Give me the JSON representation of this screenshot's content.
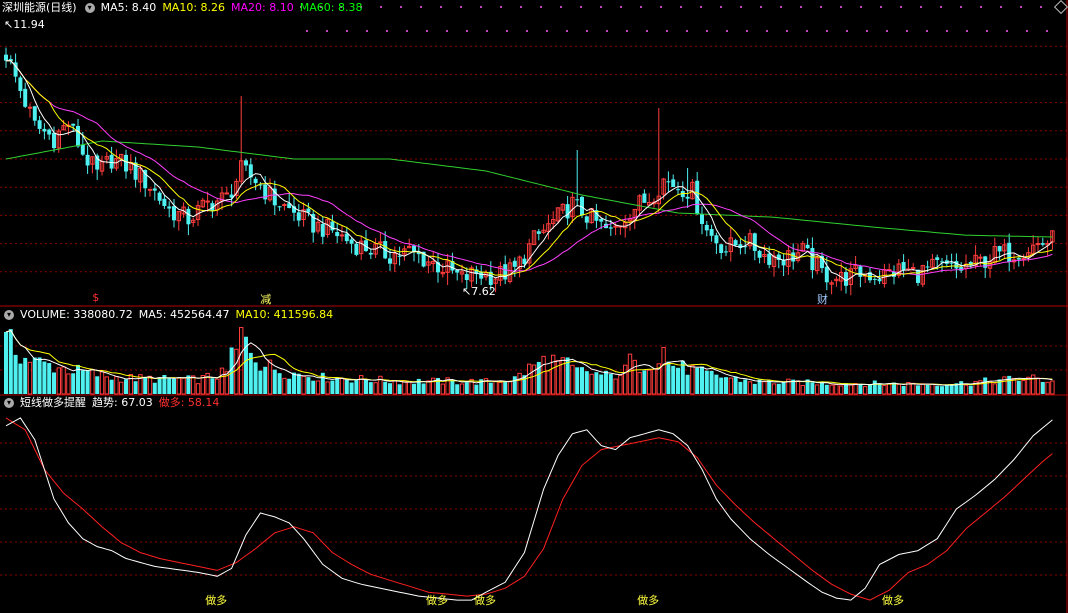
{
  "stock_name": "深圳能源",
  "period_label": "(日线)",
  "ma_legend": [
    {
      "label": "MA5: ",
      "value": "8.40",
      "color": "#ffffff"
    },
    {
      "label": "MA10: ",
      "value": "8.26",
      "color": "#ffff00"
    },
    {
      "label": "MA20: ",
      "value": "8.10",
      "color": "#ff00ff"
    },
    {
      "label": "MA60: ",
      "value": "8.38",
      "color": "#00ff00"
    }
  ],
  "high_label": "11.94",
  "low_label": "7.62",
  "event_markers": [
    {
      "text": "$",
      "color": "#ff3030",
      "bar": 19
    },
    {
      "text": "减",
      "color": "#ffff60",
      "bar": 54
    },
    {
      "text": "财",
      "color": "#a0c8ff",
      "bar": 170
    }
  ],
  "volume_legend": [
    {
      "label": "VOLUME: ",
      "value": "338080.72",
      "color": "#ffffff"
    },
    {
      "label": "MA5: ",
      "value": "452564.47",
      "color": "#ffffff"
    },
    {
      "label": "MA10: ",
      "value": "411596.84",
      "color": "#ffff00"
    }
  ],
  "indicator_legend": {
    "name": "短线做多提醒",
    "items": [
      {
        "label": "趋势: ",
        "value": "67.03",
        "color": "#ffffff"
      },
      {
        "label": "做多: ",
        "value": "58.14",
        "color": "#ff3030"
      }
    ]
  },
  "signal_label": "做多",
  "signals": [
    44,
    90,
    100,
    134,
    185
  ],
  "colors": {
    "up": "#ff3c3c",
    "down": "#4ef0f0",
    "grid": "#8b0000",
    "axis": "#b00000"
  },
  "chart_data": {
    "type": "candlestick",
    "price_ylim": [
      7.4,
      12.1
    ],
    "volume_ylim": [
      0,
      650000
    ],
    "indicator_ylim": [
      0,
      100
    ],
    "keypoints": [
      [
        0,
        11.5
      ],
      [
        3,
        10.9
      ],
      [
        6,
        10.3
      ],
      [
        10,
        10.1
      ],
      [
        13,
        10.35
      ],
      [
        16,
        9.85
      ],
      [
        19,
        9.5
      ],
      [
        22,
        9.75
      ],
      [
        26,
        9.6
      ],
      [
        30,
        9.3
      ],
      [
        34,
        8.9
      ],
      [
        38,
        8.75
      ],
      [
        42,
        9.0
      ],
      [
        46,
        9.1
      ],
      [
        49,
        9.55
      ],
      [
        52,
        9.4
      ],
      [
        56,
        9.05
      ],
      [
        60,
        8.85
      ],
      [
        64,
        8.65
      ],
      [
        68,
        8.55
      ],
      [
        72,
        8.35
      ],
      [
        76,
        8.25
      ],
      [
        80,
        8.15
      ],
      [
        84,
        8.2
      ],
      [
        88,
        8.05
      ],
      [
        92,
        7.9
      ],
      [
        95,
        7.75
      ],
      [
        98,
        7.85
      ],
      [
        102,
        7.8
      ],
      [
        106,
        7.9
      ],
      [
        110,
        8.4
      ],
      [
        114,
        8.7
      ],
      [
        118,
        9.0
      ],
      [
        122,
        8.75
      ],
      [
        126,
        8.5
      ],
      [
        130,
        8.9
      ],
      [
        134,
        9.1
      ],
      [
        137,
        9.4
      ],
      [
        140,
        9.3
      ],
      [
        143,
        9.2
      ],
      [
        146,
        8.55
      ],
      [
        150,
        8.25
      ],
      [
        154,
        8.4
      ],
      [
        158,
        8.15
      ],
      [
        162,
        8.1
      ],
      [
        166,
        8.2
      ],
      [
        170,
        7.85
      ],
      [
        174,
        7.75
      ],
      [
        178,
        7.85
      ],
      [
        182,
        7.8
      ],
      [
        186,
        7.9
      ],
      [
        190,
        7.85
      ],
      [
        194,
        7.95
      ],
      [
        198,
        7.9
      ],
      [
        202,
        8.0
      ],
      [
        206,
        8.15
      ],
      [
        210,
        8.2
      ],
      [
        214,
        8.3
      ],
      [
        218,
        8.4
      ]
    ],
    "spikes": [
      [
        16,
        10.2
      ],
      [
        49,
        10.8
      ],
      [
        136,
        10.6
      ],
      [
        142,
        9.6
      ],
      [
        119,
        9.9
      ],
      [
        4,
        10.6
      ],
      [
        92,
        7.65
      ]
    ],
    "volume_keypoints": [
      [
        0,
        500000
      ],
      [
        4,
        320000
      ],
      [
        10,
        250000
      ],
      [
        16,
        200000
      ],
      [
        22,
        150000
      ],
      [
        28,
        140000
      ],
      [
        40,
        130000
      ],
      [
        47,
        200000
      ],
      [
        49,
        560000
      ],
      [
        53,
        280000
      ],
      [
        58,
        200000
      ],
      [
        66,
        150000
      ],
      [
        80,
        120000
      ],
      [
        100,
        110000
      ],
      [
        106,
        140000
      ],
      [
        110,
        260000
      ],
      [
        114,
        300000
      ],
      [
        118,
        220000
      ],
      [
        126,
        160000
      ],
      [
        132,
        260000
      ],
      [
        136,
        320000
      ],
      [
        140,
        250000
      ],
      [
        146,
        180000
      ],
      [
        156,
        110000
      ],
      [
        170,
        100000
      ],
      [
        190,
        90000
      ],
      [
        200,
        100000
      ],
      [
        208,
        130000
      ],
      [
        214,
        140000
      ],
      [
        218,
        120000
      ]
    ],
    "volume_spikes": [
      [
        0,
        560000
      ],
      [
        47,
        420000
      ],
      [
        49,
        600000
      ],
      [
        112,
        340000
      ],
      [
        117,
        330000
      ],
      [
        130,
        360000
      ],
      [
        137,
        420000
      ]
    ],
    "ma60_keypoints": [
      [
        0,
        9.75
      ],
      [
        20,
        10.05
      ],
      [
        40,
        9.95
      ],
      [
        60,
        9.75
      ],
      [
        80,
        9.75
      ],
      [
        100,
        9.55
      ],
      [
        120,
        9.15
      ],
      [
        140,
        8.85
      ],
      [
        160,
        8.78
      ],
      [
        180,
        8.62
      ],
      [
        200,
        8.48
      ],
      [
        218,
        8.45
      ]
    ],
    "trend_keypoints": [
      [
        0,
        92
      ],
      [
        3,
        96
      ],
      [
        6,
        85
      ],
      [
        10,
        55
      ],
      [
        13,
        43
      ],
      [
        16,
        35
      ],
      [
        19,
        31
      ],
      [
        22,
        29
      ],
      [
        25,
        25
      ],
      [
        28,
        23
      ],
      [
        31,
        21
      ],
      [
        34,
        20
      ],
      [
        37,
        19
      ],
      [
        40,
        18
      ],
      [
        44,
        16
      ],
      [
        47,
        20
      ],
      [
        50,
        37
      ],
      [
        53,
        48
      ],
      [
        56,
        46
      ],
      [
        59,
        43
      ],
      [
        62,
        35
      ],
      [
        66,
        22
      ],
      [
        70,
        15
      ],
      [
        74,
        12
      ],
      [
        78,
        10
      ],
      [
        82,
        8
      ],
      [
        86,
        6
      ],
      [
        90,
        5
      ],
      [
        94,
        4
      ],
      [
        97,
        4
      ],
      [
        100,
        8
      ],
      [
        104,
        13
      ],
      [
        108,
        28
      ],
      [
        112,
        60
      ],
      [
        115,
        77
      ],
      [
        118,
        88
      ],
      [
        121,
        90
      ],
      [
        124,
        82
      ],
      [
        127,
        80
      ],
      [
        130,
        86
      ],
      [
        133,
        88
      ],
      [
        136,
        90
      ],
      [
        139,
        88
      ],
      [
        142,
        82
      ],
      [
        145,
        70
      ],
      [
        148,
        55
      ],
      [
        151,
        45
      ],
      [
        155,
        35
      ],
      [
        159,
        27
      ],
      [
        163,
        20
      ],
      [
        167,
        13
      ],
      [
        170,
        8
      ],
      [
        173,
        5
      ],
      [
        176,
        4
      ],
      [
        179,
        10
      ],
      [
        182,
        22
      ],
      [
        186,
        27
      ],
      [
        190,
        29
      ],
      [
        194,
        35
      ],
      [
        198,
        50
      ],
      [
        202,
        57
      ],
      [
        206,
        65
      ],
      [
        210,
        75
      ],
      [
        214,
        87
      ],
      [
        218,
        95
      ]
    ],
    "long_keypoints": [
      [
        0,
        96
      ],
      [
        4,
        90
      ],
      [
        8,
        70
      ],
      [
        12,
        58
      ],
      [
        16,
        50
      ],
      [
        20,
        41
      ],
      [
        24,
        33
      ],
      [
        28,
        28
      ],
      [
        32,
        25
      ],
      [
        36,
        23
      ],
      [
        40,
        21
      ],
      [
        44,
        19
      ],
      [
        48,
        23
      ],
      [
        52,
        30
      ],
      [
        56,
        38
      ],
      [
        60,
        41
      ],
      [
        64,
        38
      ],
      [
        68,
        28
      ],
      [
        72,
        22
      ],
      [
        76,
        17
      ],
      [
        80,
        14
      ],
      [
        84,
        11
      ],
      [
        88,
        8
      ],
      [
        92,
        7
      ],
      [
        96,
        6
      ],
      [
        100,
        7
      ],
      [
        104,
        10
      ],
      [
        108,
        16
      ],
      [
        112,
        30
      ],
      [
        116,
        55
      ],
      [
        120,
        72
      ],
      [
        124,
        80
      ],
      [
        128,
        82
      ],
      [
        132,
        84
      ],
      [
        136,
        86
      ],
      [
        140,
        84
      ],
      [
        144,
        76
      ],
      [
        148,
        62
      ],
      [
        152,
        52
      ],
      [
        156,
        43
      ],
      [
        160,
        35
      ],
      [
        164,
        27
      ],
      [
        168,
        19
      ],
      [
        172,
        12
      ],
      [
        176,
        7
      ],
      [
        180,
        4
      ],
      [
        184,
        9
      ],
      [
        188,
        18
      ],
      [
        192,
        22
      ],
      [
        196,
        29
      ],
      [
        200,
        40
      ],
      [
        204,
        48
      ],
      [
        208,
        56
      ],
      [
        212,
        65
      ],
      [
        216,
        74
      ],
      [
        218,
        78
      ]
    ]
  }
}
